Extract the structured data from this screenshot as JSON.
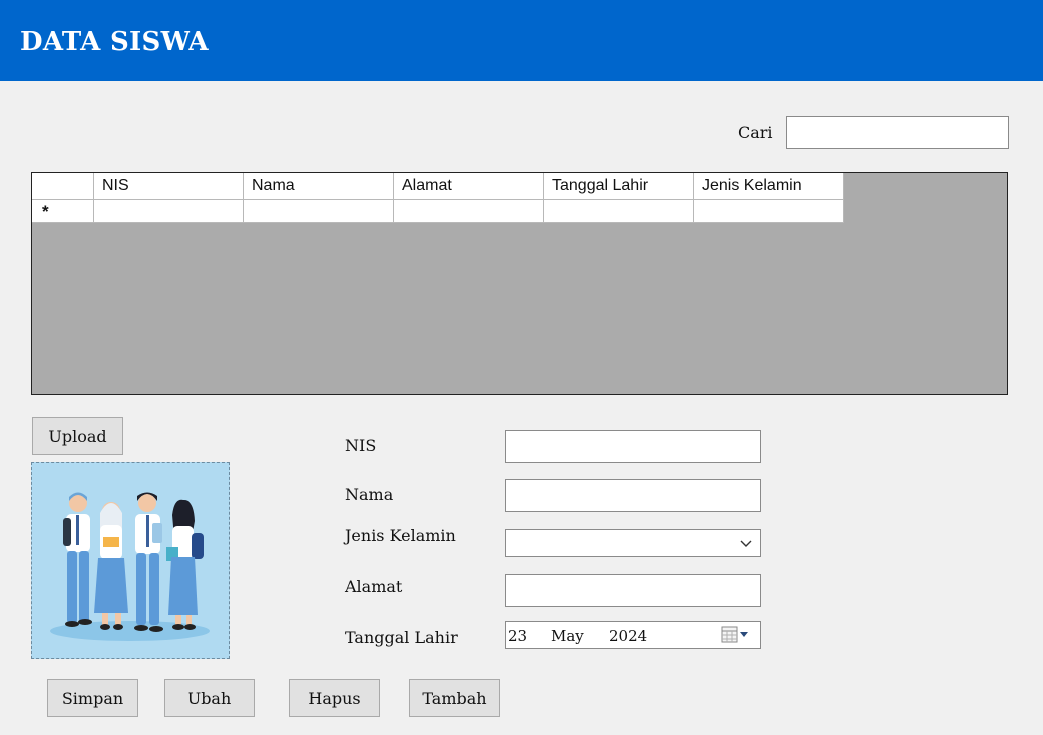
{
  "header": {
    "title": "DATA SISWA"
  },
  "search": {
    "label": "Cari",
    "value": ""
  },
  "grid": {
    "columns": [
      "NIS",
      "Nama",
      "Alamat",
      "Tanggal Lahir",
      "Jenis Kelamin"
    ],
    "new_row_marker": "*"
  },
  "upload_button": "Upload",
  "form": {
    "nis_label": "NIS",
    "nama_label": "Nama",
    "jenis_kelamin_label": "Jenis Kelamin",
    "alamat_label": "Alamat",
    "tanggal_lahir_label": "Tanggal Lahir",
    "nis_value": "",
    "nama_value": "",
    "jenis_kelamin_value": "",
    "alamat_value": "",
    "date_day": "23",
    "date_month": "May",
    "date_year": "2024"
  },
  "buttons": {
    "simpan": "Simpan",
    "ubah": "Ubah",
    "hapus": "Hapus",
    "tambah": "Tambah"
  },
  "icons": {
    "calendar": "calendar-icon",
    "dropdown": "chevron-down-icon"
  },
  "colors": {
    "header_bg": "#0066cc",
    "photo_bg": "#b0daf1",
    "grid_bg": "#ababab"
  }
}
